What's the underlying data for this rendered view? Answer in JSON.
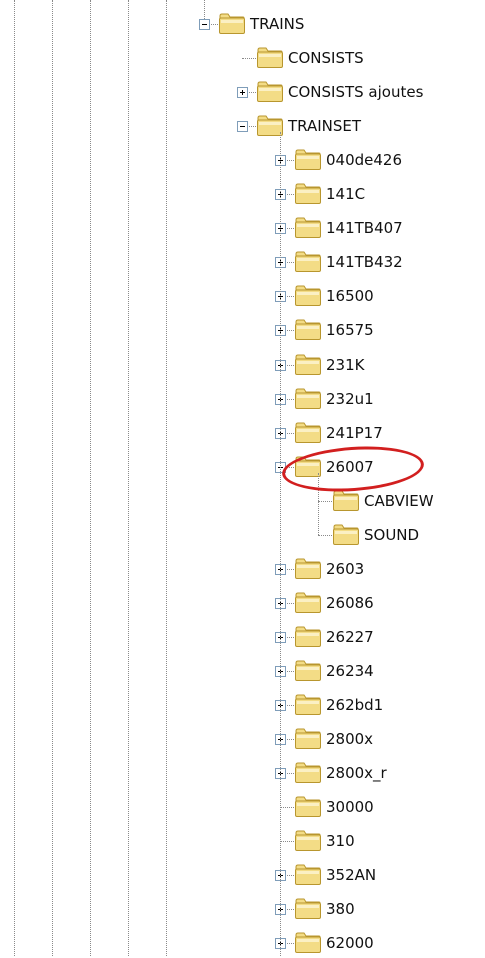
{
  "tree": {
    "root": {
      "label": "TRAINS",
      "expanded": true
    },
    "children": [
      {
        "label": "CONSISTS",
        "has_children": false
      },
      {
        "label": "CONSISTS ajoutes",
        "has_children": true,
        "expanded": false
      },
      {
        "label": "TRAINSET",
        "has_children": true,
        "expanded": true,
        "children": [
          {
            "label": "040de426",
            "has_children": true,
            "expanded": false
          },
          {
            "label": "141C",
            "has_children": true,
            "expanded": false
          },
          {
            "label": "141TB407",
            "has_children": true,
            "expanded": false
          },
          {
            "label": "141TB432",
            "has_children": true,
            "expanded": false
          },
          {
            "label": "16500",
            "has_children": true,
            "expanded": false
          },
          {
            "label": "16575",
            "has_children": true,
            "expanded": false
          },
          {
            "label": "231K",
            "has_children": true,
            "expanded": false
          },
          {
            "label": "232u1",
            "has_children": true,
            "expanded": false
          },
          {
            "label": "241P17",
            "has_children": true,
            "expanded": false
          },
          {
            "label": "26007",
            "has_children": true,
            "expanded": true,
            "highlighted": true,
            "children": [
              {
                "label": "CABVIEW",
                "has_children": false
              },
              {
                "label": "SOUND",
                "has_children": false
              }
            ]
          },
          {
            "label": "2603",
            "has_children": true,
            "expanded": false
          },
          {
            "label": "26086",
            "has_children": true,
            "expanded": false
          },
          {
            "label": "26227",
            "has_children": true,
            "expanded": false
          },
          {
            "label": "26234",
            "has_children": true,
            "expanded": false
          },
          {
            "label": "262bd1",
            "has_children": true,
            "expanded": false
          },
          {
            "label": "2800x",
            "has_children": true,
            "expanded": false
          },
          {
            "label": "2800x_r",
            "has_children": true,
            "expanded": false
          },
          {
            "label": "30000",
            "has_children": false
          },
          {
            "label": "310",
            "has_children": false
          },
          {
            "label": "352AN",
            "has_children": true,
            "expanded": false
          },
          {
            "label": "380",
            "has_children": true,
            "expanded": false
          },
          {
            "label": "62000",
            "has_children": true,
            "expanded": false
          }
        ]
      }
    ]
  },
  "colors": {
    "folder_fill": "#f3dc86",
    "folder_edge": "#b8962e",
    "annotation": "#d21f1f"
  },
  "icons": {
    "folder": "folder-icon",
    "expand": "plus-icon",
    "collapse": "minus-icon"
  }
}
